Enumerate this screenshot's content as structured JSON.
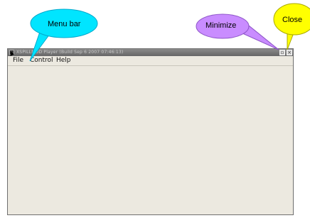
{
  "window": {
    "title": "XSPILLMOD Player (Build Sep 6 2007 07:46:13)",
    "menu": [
      {
        "label": "File"
      },
      {
        "label": "Control"
      },
      {
        "label": "Help"
      }
    ],
    "minimize_glyph": "▫",
    "close_glyph": "×"
  },
  "callouts": {
    "menu_bar": "Menu bar",
    "minimize": "Minimize",
    "close": "Close"
  },
  "colors": {
    "callout_menu_bar": "#00e5ff",
    "callout_minimize": "#c98cff",
    "callout_close": "#ffff00",
    "window_bg": "#ece9e0",
    "titlebar": "#6f6f6f"
  },
  "icons": {
    "app": "app-icon",
    "minimize": "minimize-icon",
    "close": "close-icon"
  }
}
